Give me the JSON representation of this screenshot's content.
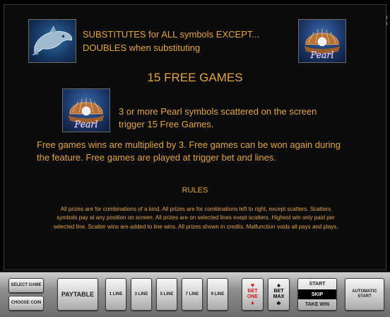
{
  "window_controls": {
    "fullscreen_icon": "expand-icon",
    "sound_icon": "speaker-icon"
  },
  "info": {
    "substitute_line1": "SUBSTITUTES for ALL symbols EXCEPT...",
    "substitute_line2": "DOUBLES when substituting",
    "free_games_title": "15 FREE GAMES",
    "pearl_line1": "3 or more Pearl symbols scattered on the screen",
    "pearl_line2": "trigger 15 Free Games.",
    "free_line1": "Free games wins are multiplied by 3. Free games can be won again during",
    "free_line2": "the feature. Free games are played at trigger bet and lines.",
    "rules_title": "RULES",
    "rules_line1": "All prizes are for combinations of a kind. All prizes are for combinations left to right, except scatters. Scatters",
    "rules_line2": "symbols pay at any position on screen. All prizes are on selected lines exept scatters. Highest win only paid per",
    "rules_line3": "selected line. Scatter wins are added to line wins. All prizes shown in credits. Malfunction voids all pays and plays.",
    "pearl_symbol_label": "Pearl"
  },
  "controls": {
    "select_game": "SELECT GAME",
    "choose_coin": "CHOOSE COIN",
    "paytable": "PAYTABLE",
    "lines": [
      "1 LINE",
      "3 LINE",
      "5 LINE",
      "7 LINE",
      "9 LINE"
    ],
    "bet_one_top": "BET",
    "bet_one_bottom": "ONE",
    "bet_max_top": "BET",
    "bet_max_bottom": "MAX",
    "start": "START",
    "skip": "SKIP",
    "take_win": "TAKE WIN",
    "auto_start_top": "AUTOMATIC",
    "auto_start_bottom": "START"
  },
  "colors": {
    "text_gold": "#e3a53c",
    "panel_bg": "#0b0b0b",
    "bet_red": "#d51a1a"
  }
}
